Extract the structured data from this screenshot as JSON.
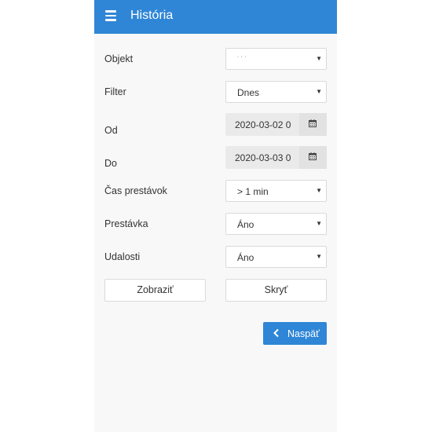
{
  "header": {
    "title": "História",
    "menu_icon": "hamburger-menu-icon"
  },
  "form": {
    "objekt": {
      "label": "Objekt",
      "value": "' ' '"
    },
    "filter": {
      "label": "Filter",
      "value": "Dnes"
    },
    "od": {
      "label": "Od",
      "value": "2020-03-02 0",
      "icon": "calendar-icon"
    },
    "do": {
      "label": "Do",
      "value": "2020-03-03 0",
      "icon": "calendar-icon"
    },
    "cas_prestavok": {
      "label": "Čas prestávok",
      "value": "> 1 min"
    },
    "prestavka": {
      "label": "Prestávka",
      "value": "Áno"
    },
    "udalosti": {
      "label": "Udalosti",
      "value": "Áno"
    }
  },
  "actions": {
    "show_label": "Zobraziť",
    "hide_label": "Skryť",
    "back_label": "Naspäť",
    "back_icon": "chevron-left-icon"
  },
  "colors": {
    "accent": "#2f86d6",
    "background": "#f8f8f8",
    "date_field": "#eaeaea"
  }
}
